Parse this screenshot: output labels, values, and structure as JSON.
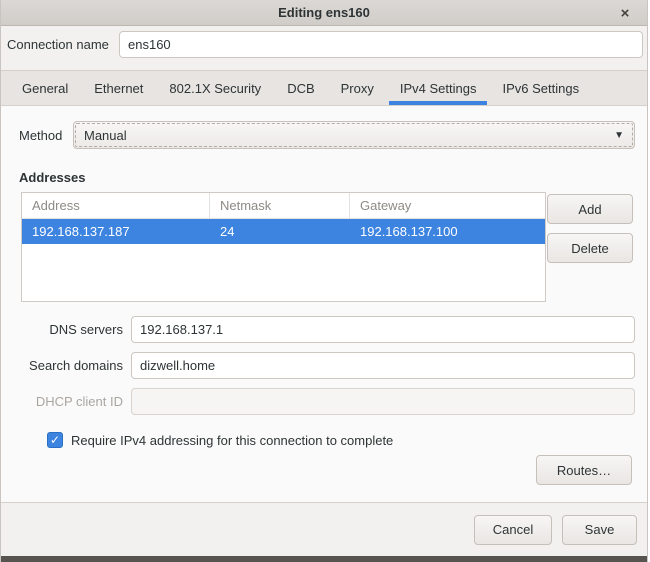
{
  "window": {
    "title": "Editing ens160",
    "close_icon": "×"
  },
  "connection": {
    "label": "Connection name",
    "value": "ens160"
  },
  "tabs": [
    {
      "label": "General",
      "active": false
    },
    {
      "label": "Ethernet",
      "active": false
    },
    {
      "label": "802.1X Security",
      "active": false
    },
    {
      "label": "DCB",
      "active": false
    },
    {
      "label": "Proxy",
      "active": false
    },
    {
      "label": "IPv4 Settings",
      "active": true
    },
    {
      "label": "IPv6 Settings",
      "active": false
    }
  ],
  "ipv4": {
    "method_label": "Method",
    "method_value": "Manual",
    "addresses_label": "Addresses",
    "table": {
      "columns": [
        "Address",
        "Netmask",
        "Gateway"
      ],
      "rows": [
        {
          "address": "192.168.137.187",
          "netmask": "24",
          "gateway": "192.168.137.100",
          "selected": true
        }
      ]
    },
    "add_button": "Add",
    "delete_button": "Delete",
    "dns_label": "DNS servers",
    "dns_value": "192.168.137.1",
    "search_label": "Search domains",
    "search_value": "dizwell.home",
    "dhcp_label": "DHCP client ID",
    "dhcp_value": "",
    "require_checkbox_label": "Require IPv4 addressing for this connection to complete",
    "require_checked": true,
    "check_glyph": "✓",
    "routes_button": "Routes…",
    "dropdown_arrow": "▼"
  },
  "actions": {
    "cancel": "Cancel",
    "save": "Save"
  },
  "colors": {
    "accent": "#3d84e0",
    "selection": "#3d84e0",
    "titlebar": "#d6d2ce",
    "content_bg": "#fbfafa"
  }
}
